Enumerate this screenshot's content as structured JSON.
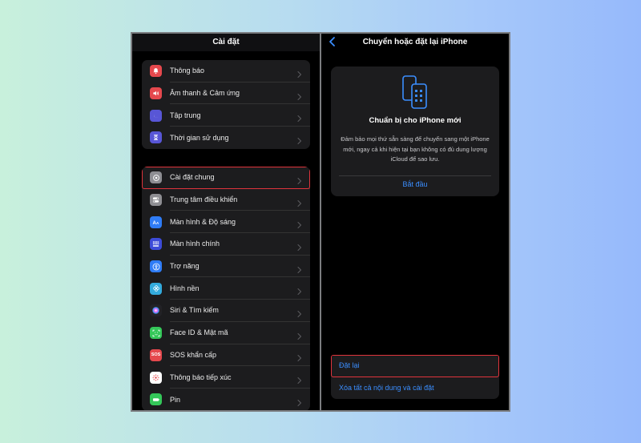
{
  "left_screen": {
    "title": "Cài đặt",
    "group1": [
      {
        "label": "Thông báo",
        "icon": "bell-icon",
        "color": "#e5484d"
      },
      {
        "label": "Âm thanh & Cảm ứng",
        "icon": "speaker-icon",
        "color": "#e5484d"
      },
      {
        "label": "Tập trung",
        "icon": "moon-icon",
        "color": "#5856d6"
      },
      {
        "label": "Thời gian sử dụng",
        "icon": "hourglass-icon",
        "color": "#5856d6"
      }
    ],
    "group2": [
      {
        "label": "Cài đặt chung",
        "icon": "gear-icon",
        "color": "#8e8e93"
      },
      {
        "label": "Trung tâm điều khiển",
        "icon": "toggles-icon",
        "color": "#8e8e93"
      },
      {
        "label": "Màn hình & Độ sáng",
        "icon": "text-size-icon",
        "color": "#2f7cf6"
      },
      {
        "label": "Màn hình chính",
        "icon": "app-grid-icon",
        "color": "#3d4bd8"
      },
      {
        "label": "Trợ năng",
        "icon": "accessibility-icon",
        "color": "#2f7cf6"
      },
      {
        "label": "Hình nền",
        "icon": "flower-icon",
        "color": "#33aadc"
      },
      {
        "label": "Siri & Tìm kiếm",
        "icon": "siri-icon",
        "color": "#222226"
      },
      {
        "label": "Face ID & Mật mã",
        "icon": "face-id-icon",
        "color": "#34c759"
      },
      {
        "label": "SOS khẩn cấp",
        "icon": "sos-icon",
        "color": "#e5484d",
        "icon_text": "SOS"
      },
      {
        "label": "Thông báo tiếp xúc",
        "icon": "exposure-icon",
        "color": "#ffffff"
      },
      {
        "label": "Pin",
        "icon": "battery-icon",
        "color": "#34c759"
      }
    ]
  },
  "right_screen": {
    "title": "Chuyển hoặc đặt lại iPhone",
    "card": {
      "title": "Chuẩn bị cho iPhone mới",
      "body": "Đảm bảo mọi thứ sẵn sàng để chuyển sang một iPhone mới, ngay cả khi hiện tại bạn không có đủ dung lượng iCloud để sao lưu.",
      "action": "Bắt đầu"
    },
    "reset_label": "Đặt lại",
    "erase_label": "Xóa tất cả nội dung và cài đặt"
  },
  "colors": {
    "accent": "#3b8eff",
    "highlight": "#e0343c"
  }
}
